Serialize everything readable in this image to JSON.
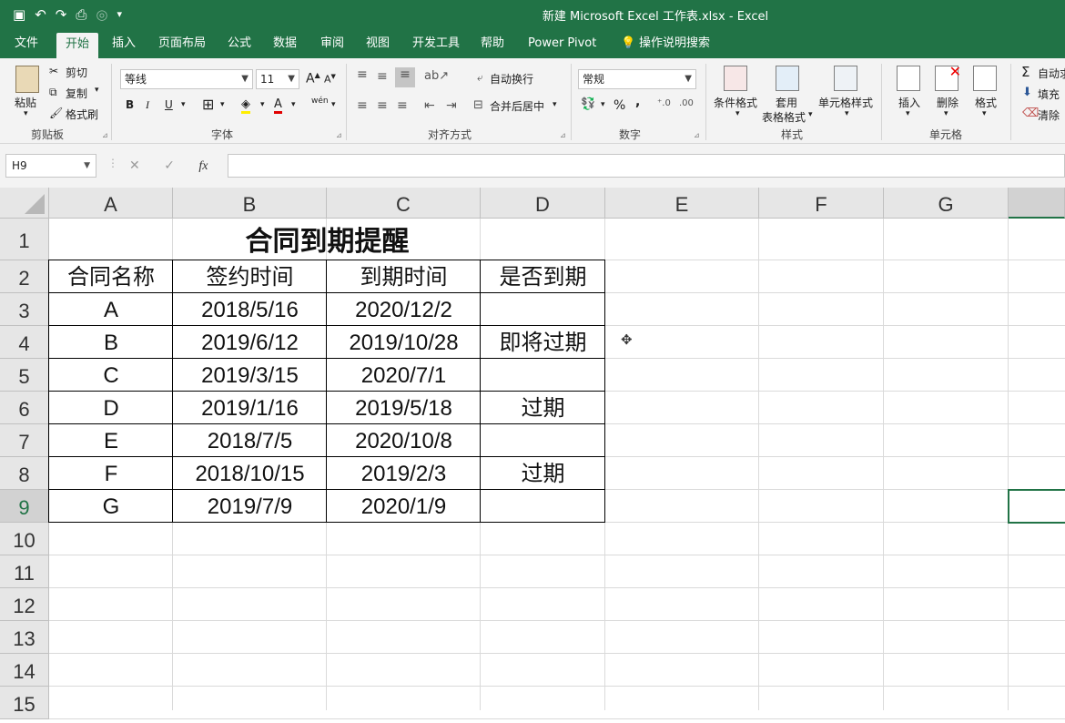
{
  "window": {
    "title": "新建 Microsoft Excel 工作表.xlsx  -  Excel"
  },
  "ribbon_tabs": [
    "文件",
    "开始",
    "插入",
    "页面布局",
    "公式",
    "数据",
    "审阅",
    "视图",
    "开发工具",
    "帮助",
    "Power Pivot",
    "操作说明搜索"
  ],
  "clipboard": {
    "paste": "粘贴",
    "cut": "剪切",
    "copy": "复制",
    "format_painter": "格式刷",
    "label": "剪贴板"
  },
  "font": {
    "name": "等线",
    "size": "11",
    "bold": "B",
    "italic": "I",
    "underline": "U",
    "label": "字体",
    "grow": "A",
    "shrink": "A",
    "wen": "wén"
  },
  "alignment": {
    "wrap": "自动换行",
    "merge": "合并后居中",
    "label": "对齐方式"
  },
  "number": {
    "format": "常规",
    "percent": "%",
    "comma": ",",
    "label": "数字"
  },
  "styles": {
    "conditional": "条件格式",
    "table_line1": "套用",
    "table_line2": "表格格式",
    "cell_styles": "单元格样式",
    "label": "样式"
  },
  "cells": {
    "insert": "插入",
    "delete": "删除",
    "format": "格式",
    "label": "单元格"
  },
  "editing": {
    "autosum": "自动求",
    "fill": "填充",
    "clear": "清除"
  },
  "formula_bar": {
    "name_box": "H9",
    "fx": "fx",
    "value": ""
  },
  "columns": [
    "A",
    "B",
    "C",
    "D",
    "E",
    "F",
    "G"
  ],
  "rows": [
    "1",
    "2",
    "3",
    "4",
    "5",
    "6",
    "7",
    "8",
    "9",
    "10",
    "11",
    "12",
    "13",
    "14",
    "15"
  ],
  "sheet": {
    "title": "合同到期提醒",
    "headers": [
      "合同名称",
      "签约时间",
      "到期时间",
      "是否到期"
    ],
    "data": [
      [
        "A",
        "2018/5/16",
        "2020/12/2",
        ""
      ],
      [
        "B",
        "2019/6/12",
        "2019/10/28",
        "即将过期"
      ],
      [
        "C",
        "2019/3/15",
        "2020/7/1",
        ""
      ],
      [
        "D",
        "2019/1/16",
        "2019/5/18",
        "过期"
      ],
      [
        "E",
        "2018/7/5",
        "2020/10/8",
        ""
      ],
      [
        "F",
        "2018/10/15",
        "2019/2/3",
        "过期"
      ],
      [
        "G",
        "2019/7/9",
        "2020/1/9",
        ""
      ]
    ]
  },
  "colors": {
    "accent": "#217346",
    "ribbon": "#f3f3f3",
    "header": "#e6e6e6"
  }
}
